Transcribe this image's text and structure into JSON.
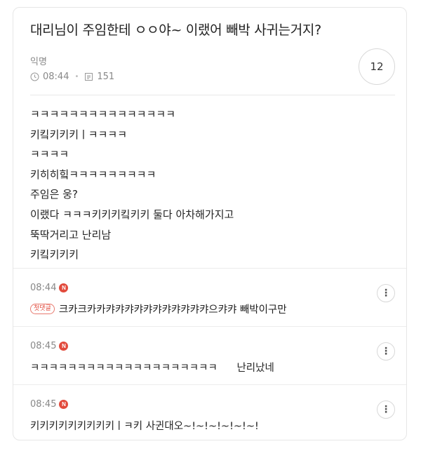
{
  "post": {
    "title": "대리님이 주임한테 ㅇㅇ야~ 이랬어 빼박 사귀는거지?",
    "author": "익명",
    "time": "08:44",
    "views": "151",
    "comment_count": "12",
    "body_lines": [
      "ㅋㅋㅋㅋㅋㅋㅋㅋㅋㅋㅋㅋㅋㅋㅋ",
      "키킼키키키ㅣㅋㅋㅋㅋ",
      "ㅋㅋㅋㅋ",
      "키히히힠ㅋㅋㅋㅋㅋㅋㅋㅋㅋ",
      "주임은 웅?",
      "이랬다 ㅋㅋㅋ키키키킼키키 둘다 아차해가지고",
      "뚝딱거리고 난리남",
      "키킼키키키"
    ]
  },
  "comments": [
    {
      "time": "08:44",
      "badge": "N",
      "tag": "첫댓글",
      "text": "크카크카카캬캬캬캬캬캬캬캬캬캬캬으캬캬 빼박이구만"
    },
    {
      "time": "08:45",
      "badge": "N",
      "text": "ㅋㅋㅋㅋㅋㅋㅋㅋㅋㅋㅋㅋㅋㅋㅋㅋㅋㅋㅋㅋ      난리났네"
    },
    {
      "time": "08:45",
      "badge": "N",
      "text": "키키키키키키키키키ㅣㅋ키 사귄대오~!~!~!~!~!~!"
    }
  ],
  "icons": {
    "clock": "clock-icon",
    "views": "document-icon",
    "more": "more-vertical-icon",
    "new_badge": "new-badge"
  },
  "colors": {
    "accent_red": "#e24a3c",
    "text": "#222222",
    "muted": "#888888",
    "border": "#e6e6e6"
  }
}
